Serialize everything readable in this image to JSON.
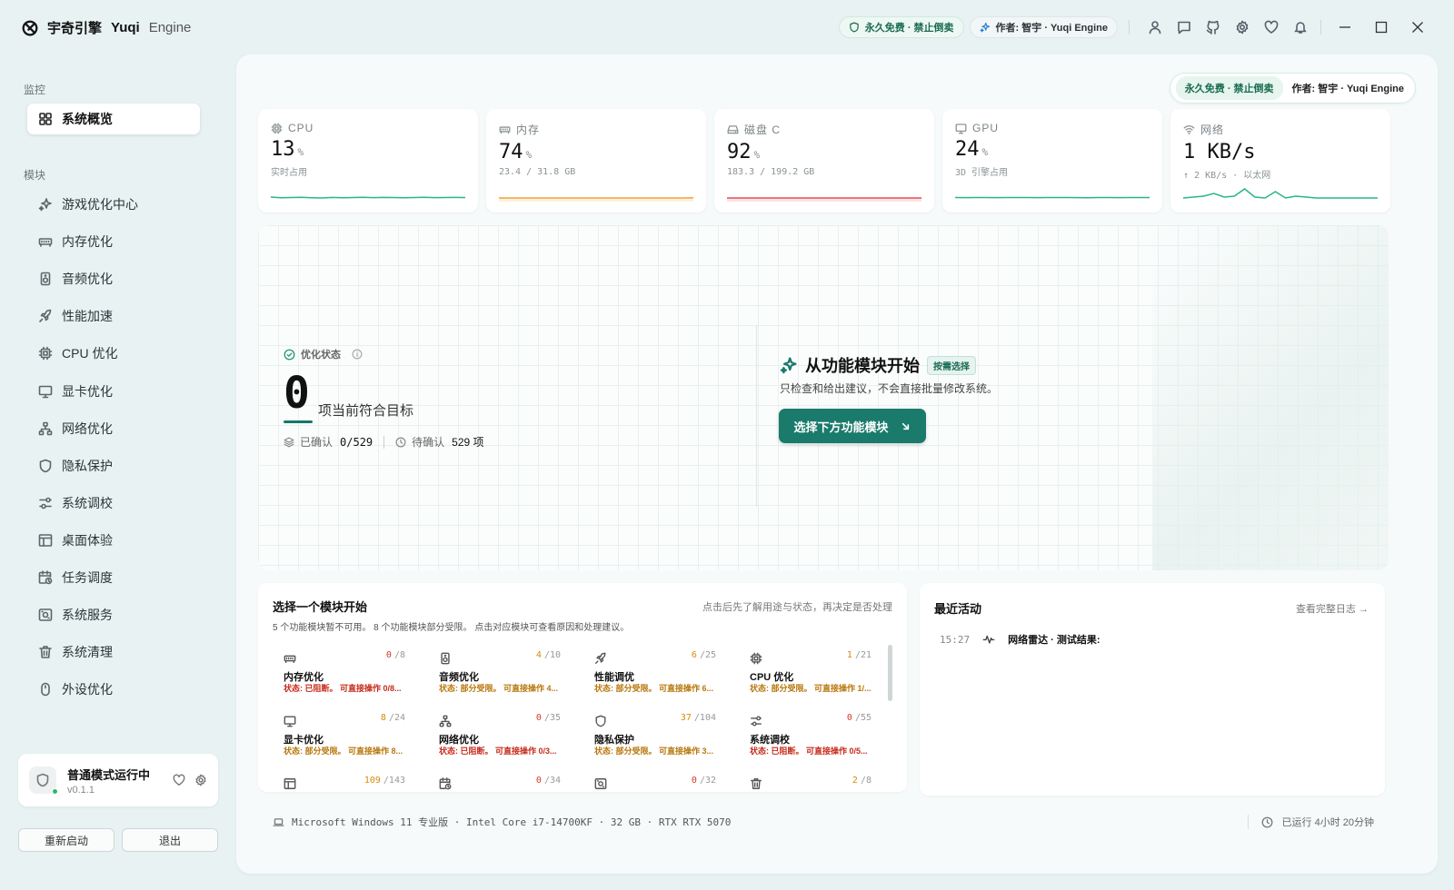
{
  "app": {
    "title_cn": "宇奇引擎",
    "title_en": "Yuqi",
    "title_engine": "Engine"
  },
  "titlebar": {
    "free_badge": "永久免费 · 禁止倒卖",
    "author_badge": "作者: 智宇 · Yuqi Engine",
    "icons": [
      "user-icon",
      "chat-icon",
      "github-icon",
      "gear-icon",
      "heart-icon",
      "bell-icon"
    ],
    "window_controls": [
      "minimize-icon",
      "maximize-icon",
      "close-icon"
    ]
  },
  "sidebar": {
    "section_monitor": "监控",
    "section_modules": "模块",
    "active_item": "系统概览",
    "items": [
      {
        "label": "游戏优化中心",
        "icon": "sparkle-icon"
      },
      {
        "label": "内存优化",
        "icon": "memory-icon"
      },
      {
        "label": "音频优化",
        "icon": "speaker-icon"
      },
      {
        "label": "性能加速",
        "icon": "rocket-icon"
      },
      {
        "label": "CPU 优化",
        "icon": "cpu-icon"
      },
      {
        "label": "显卡优化",
        "icon": "monitor-icon"
      },
      {
        "label": "网络优化",
        "icon": "network-icon"
      },
      {
        "label": "隐私保护",
        "icon": "shield-icon"
      },
      {
        "label": "系统调校",
        "icon": "sliders-icon"
      },
      {
        "label": "桌面体验",
        "icon": "layout-icon"
      },
      {
        "label": "任务调度",
        "icon": "calendar-clock-icon"
      },
      {
        "label": "系统服务",
        "icon": "service-icon"
      },
      {
        "label": "系统清理",
        "icon": "trash-icon"
      },
      {
        "label": "外设优化",
        "icon": "mouse-icon"
      }
    ],
    "mode": {
      "title": "普通模式运行中",
      "version": "v0.1.1"
    },
    "restart_label": "重新启动",
    "exit_label": "退出"
  },
  "main": {
    "badge_free": "永久免费 · 禁止倒卖",
    "badge_author": "作者: 智宇 · Yuqi Engine"
  },
  "stats": [
    {
      "label": "CPU",
      "value": "13",
      "unit": "%",
      "sub": "实时占用",
      "color": "#2bb58a",
      "fill": ""
    },
    {
      "label": "内存",
      "value": "74",
      "unit": "%",
      "sub": "23.4 / 31.8 GB",
      "color": "#f0a43a",
      "fill": "#fdf0dc"
    },
    {
      "label": "磁盘 C",
      "value": "92",
      "unit": "%",
      "sub": "183.3 / 199.2 GB",
      "color": "#e0505a",
      "fill": "#fbe3e5"
    },
    {
      "label": "GPU",
      "value": "24",
      "unit": "%",
      "sub": "3D 引擎占用",
      "color": "#2bb58a",
      "fill": ""
    },
    {
      "label": "网络",
      "value": "1 KB/s",
      "unit": "",
      "sub": "↑ 2 KB/s · 以太网",
      "color": "#2bb58a",
      "fill": ""
    }
  ],
  "optimize": {
    "label": "优化状态",
    "count": "0",
    "count_text": "项当前符合目标",
    "confirmed_label": "已确认",
    "confirmed_value": "0/529",
    "pending_label": "待确认",
    "pending_value": "529 项"
  },
  "start": {
    "title": "从功能模块开始",
    "tag": "按需选择",
    "subtitle": "只检查和给出建议，不会直接批量修改系统。",
    "button": "选择下方功能模块"
  },
  "modules": {
    "title": "选择一个模块开始",
    "hint": "点击后先了解用途与状态，再决定是否处理",
    "desc": "5 个功能模块暂不可用。 8 个功能模块部分受限。 点击对应模块可查看原因和处理建议。",
    "items": [
      {
        "name": "内存优化",
        "icon": "memory-icon",
        "done": "0",
        "total": "/8",
        "level": "red",
        "status": "状态: 已阻断。 可直接操作 0/8..."
      },
      {
        "name": "音频优化",
        "icon": "speaker-icon",
        "done": "4",
        "total": "/10",
        "level": "org",
        "status": "状态: 部分受限。 可直接操作 4..."
      },
      {
        "name": "性能调优",
        "icon": "rocket-icon",
        "done": "6",
        "total": "/25",
        "level": "org",
        "status": "状态: 部分受限。 可直接操作 6..."
      },
      {
        "name": "CPU 优化",
        "icon": "cpu-icon",
        "done": "1",
        "total": "/21",
        "level": "org",
        "status": "状态: 部分受限。 可直接操作 1/..."
      },
      {
        "name": "显卡优化",
        "icon": "monitor-icon",
        "done": "8",
        "total": "/24",
        "level": "org",
        "status": "状态: 部分受限。 可直接操作 8..."
      },
      {
        "name": "网络优化",
        "icon": "network-icon",
        "done": "0",
        "total": "/35",
        "level": "red",
        "status": "状态: 已阻断。 可直接操作 0/3..."
      },
      {
        "name": "隐私保护",
        "icon": "shield-icon",
        "done": "37",
        "total": "/104",
        "level": "org",
        "status": "状态: 部分受限。 可直接操作 3..."
      },
      {
        "name": "系统调校",
        "icon": "sliders-icon",
        "done": "0",
        "total": "/55",
        "level": "red",
        "status": "状态: 已阻断。 可直接操作 0/5..."
      },
      {
        "name": "",
        "icon": "layout-icon",
        "done": "109",
        "total": "/143",
        "level": "org",
        "status": ""
      },
      {
        "name": "",
        "icon": "calendar-clock-icon",
        "done": "0",
        "total": "/34",
        "level": "red",
        "status": ""
      },
      {
        "name": "",
        "icon": "service-icon",
        "done": "0",
        "total": "/32",
        "level": "red",
        "status": ""
      },
      {
        "name": "",
        "icon": "trash-icon",
        "done": "2",
        "total": "/8",
        "level": "org",
        "status": ""
      }
    ]
  },
  "activity": {
    "title": "最近活动",
    "link": "查看完整日志 →",
    "entries": [
      {
        "time": "15:27",
        "text": "网络雷达 · 测试结果:"
      }
    ]
  },
  "footer": {
    "system": "Microsoft Windows 11 专业版 · Intel Core i7-14700KF · 32 GB · RTX RTX 5070",
    "uptime": "已运行 4小时 20分钟"
  }
}
